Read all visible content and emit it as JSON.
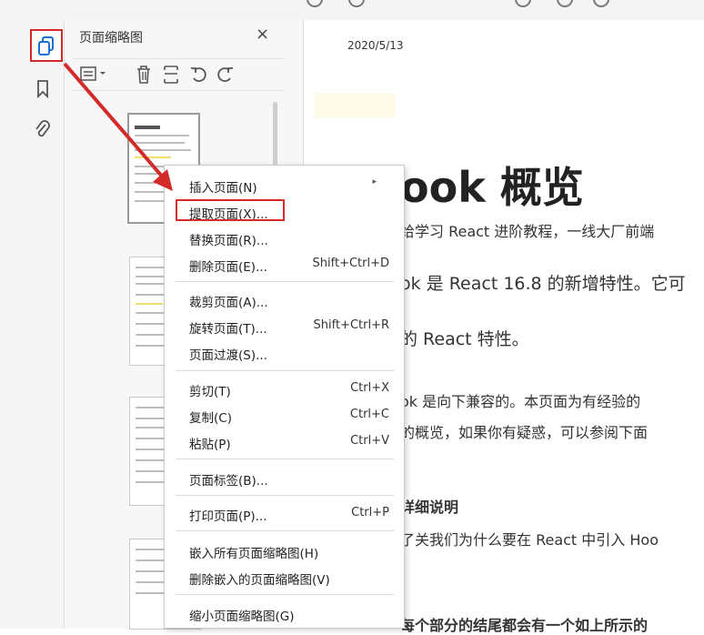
{
  "panel": {
    "title": "页面缩略图",
    "close": "×"
  },
  "document": {
    "date": "2020/5/13",
    "title": "ook 概览",
    "lines": [
      "给学习 React 进阶教程，一线大厂前端",
      "ok 是 React 16.8 的新增特性。它可",
      "的 React 特性。",
      "ok 是向下兼容的。本页面为有经验的",
      "的概览，如果你有疑惑，可以参阅下面",
      "详细说明",
      "了关我们为什么要在 React 中引入 Hoo",
      "每个部分的结尾都会有一个如上所示的"
    ]
  },
  "menu": {
    "items": [
      {
        "label": "插入页面(N)",
        "shortcut": "",
        "submenu": true
      },
      {
        "label": "提取页面(X)...",
        "shortcut": ""
      },
      {
        "label": "替换页面(R)...",
        "shortcut": ""
      },
      {
        "label": "删除页面(E)...",
        "shortcut": "Shift+Ctrl+D"
      },
      {
        "label": "裁剪页面(A)...",
        "shortcut": ""
      },
      {
        "label": "旋转页面(T)...",
        "shortcut": "Shift+Ctrl+R"
      },
      {
        "label": "页面过渡(S)...",
        "shortcut": ""
      },
      {
        "label": "剪切(T)",
        "shortcut": "Ctrl+X"
      },
      {
        "label": "复制(C)",
        "shortcut": "Ctrl+C"
      },
      {
        "label": "粘贴(P)",
        "shortcut": "Ctrl+V"
      },
      {
        "label": "页面标签(B)...",
        "shortcut": ""
      },
      {
        "label": "打印页面(P)...",
        "shortcut": "Ctrl+P"
      },
      {
        "label": "嵌入所有页面缩略图(H)",
        "shortcut": ""
      },
      {
        "label": "删除嵌入的页面缩略图(V)",
        "shortcut": ""
      },
      {
        "label": "缩小页面缩略图(G)",
        "shortcut": ""
      }
    ]
  },
  "colors": {
    "annotation_red": "#d32a2a"
  }
}
